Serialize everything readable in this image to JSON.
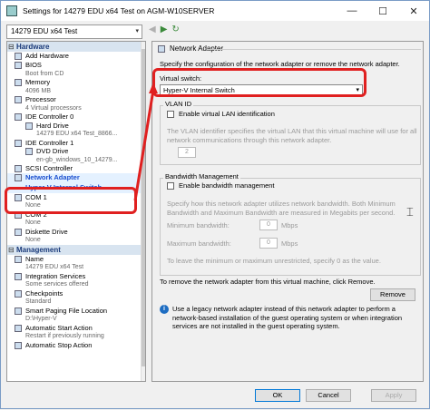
{
  "window": {
    "title": "Settings for 14279 EDU x64 Test on AGM-W10SERVER",
    "min": "—",
    "max": "☐",
    "close": "✕"
  },
  "vm_selector": {
    "value": "14279 EDU x64 Test",
    "arrow": "▾"
  },
  "nav": {
    "back": "◀",
    "forward": "▶",
    "refresh": "↻"
  },
  "tree": {
    "hardware_label": "Hardware",
    "items": [
      {
        "label": "Add Hardware",
        "sub": ""
      },
      {
        "label": "BIOS",
        "sub": "Boot from CD"
      },
      {
        "label": "Memory",
        "sub": "4096 MB"
      },
      {
        "label": "Processor",
        "sub": "4 Virtual processors"
      },
      {
        "label": "IDE Controller 0",
        "sub": ""
      },
      {
        "label": "Hard Drive",
        "sub": "14279 EDU x64 Test_8866..."
      },
      {
        "label": "IDE Controller 1",
        "sub": ""
      },
      {
        "label": "DVD Drive",
        "sub": "en-gb_windows_10_14279..."
      },
      {
        "label": "SCSI Controller",
        "sub": ""
      },
      {
        "label": "Network Adapter",
        "sub": "Hyper-V Internal Switch"
      },
      {
        "label": "COM 1",
        "sub": "None"
      },
      {
        "label": "COM 2",
        "sub": "None"
      },
      {
        "label": "Diskette Drive",
        "sub": "None"
      }
    ],
    "management_label": "Management",
    "mgmt": [
      {
        "label": "Name",
        "sub": "14279 EDU x64 Test"
      },
      {
        "label": "Integration Services",
        "sub": "Some services offered"
      },
      {
        "label": "Checkpoints",
        "sub": "Standard"
      },
      {
        "label": "Smart Paging File Location",
        "sub": "D:\\Hyper-V"
      },
      {
        "label": "Automatic Start Action",
        "sub": "Restart if previously running"
      },
      {
        "label": "Automatic Stop Action",
        "sub": ""
      }
    ]
  },
  "panel": {
    "header": "Network Adapter",
    "intro": "Specify the configuration of the network adapter or remove the network adapter.",
    "vswitch_label": "Virtual switch:",
    "vswitch_value": "Hyper-V Internal Switch",
    "vlan_group": "VLAN ID",
    "vlan_cb": "Enable virtual LAN identification",
    "vlan_desc": "The VLAN identifier specifies the virtual LAN that this virtual machine will use for all network communications through this network adapter.",
    "vlan_value": "2",
    "bw_group": "Bandwidth Management",
    "bw_cb": "Enable bandwidth management",
    "bw_desc": "Specify how this network adapter utilizes network bandwidth. Both Minimum Bandwidth and Maximum Bandwidth are measured in Megabits per second.",
    "min_label": "Minimum bandwidth:",
    "max_label": "Maximum bandwidth:",
    "min_value": "0",
    "max_value": "0",
    "unit": "Mbps",
    "zero_note": "To leave the minimum or maximum unrestricted, specify 0 as the value.",
    "remove_text": "To remove the network adapter from this virtual machine, click Remove.",
    "remove_btn": "Remove",
    "legacy_note": "Use a legacy network adapter instead of this network adapter to perform a network-based installation of the guest operating system or when integration services are not installed in the guest operating system.",
    "info_icon": "i"
  },
  "footer": {
    "ok": "OK",
    "cancel": "Cancel",
    "apply": "Apply"
  },
  "colors": {
    "highlight": "#e02020",
    "accent": "#1a4fcf"
  }
}
